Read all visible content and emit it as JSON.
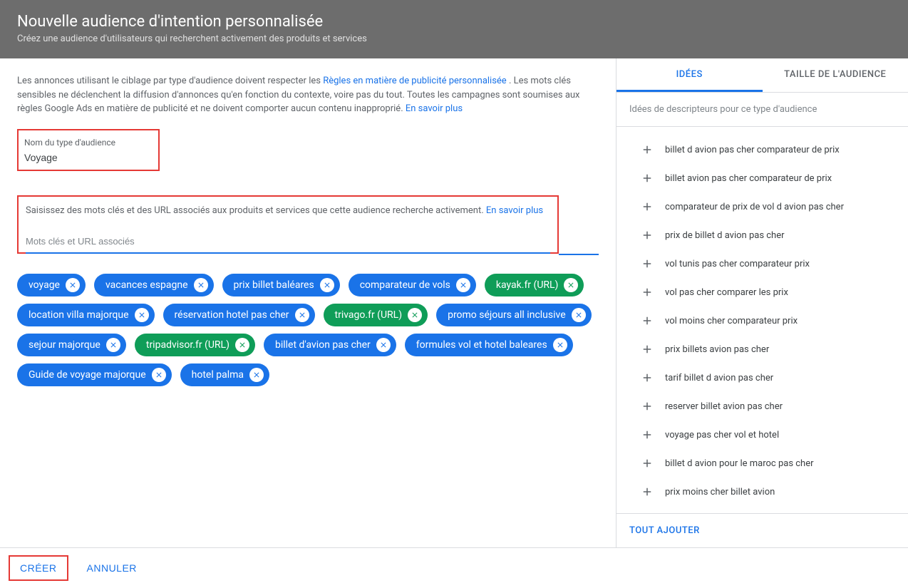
{
  "header": {
    "title": "Nouvelle audience d'intention personnalisée",
    "subtitle": "Créez une audience d'utilisateurs qui recherchent activement des produits et services"
  },
  "policy": {
    "text_before": "Les annonces utilisant le ciblage par type d'audience doivent respecter les ",
    "link1": "Règles en matière de publicité personnalisée",
    "text_mid": ". Les mots clés sensibles ne déclenchent la diffusion d'annonces qu'en fonction du contexte, voire pas du tout. Toutes les campagnes sont soumises aux règles Google Ads en matière de publicité et ne doivent comporter aucun contenu inapproprié. ",
    "link2": "En savoir plus"
  },
  "name_field": {
    "label": "Nom du type d'audience",
    "value": "Voyage"
  },
  "keywords_section": {
    "instruction": "Saisissez des mots clés et des URL associés aux produits et services que cette audience recherche activement. ",
    "learn_more": "En savoir plus",
    "placeholder": "Mots clés et URL associés"
  },
  "chips": [
    {
      "label": "voyage",
      "type": "kw"
    },
    {
      "label": "vacances espagne",
      "type": "kw"
    },
    {
      "label": "prix billet baléares",
      "type": "kw"
    },
    {
      "label": "comparateur de vols",
      "type": "kw"
    },
    {
      "label": "kayak.fr (URL)",
      "type": "url"
    },
    {
      "label": "location villa majorque",
      "type": "kw"
    },
    {
      "label": "réservation hotel pas cher",
      "type": "kw"
    },
    {
      "label": "trivago.fr (URL)",
      "type": "url"
    },
    {
      "label": "promo séjours all inclusive",
      "type": "kw"
    },
    {
      "label": "sejour majorque",
      "type": "kw"
    },
    {
      "label": "tripadvisor.fr (URL)",
      "type": "url"
    },
    {
      "label": "billet d'avion pas cher",
      "type": "kw"
    },
    {
      "label": "formules vol et hotel baleares",
      "type": "kw"
    },
    {
      "label": "Guide de voyage majorque",
      "type": "kw"
    },
    {
      "label": "hotel palma",
      "type": "kw"
    }
  ],
  "tabs": {
    "ideas": "IDÉES",
    "size": "TAILLE DE L'AUDIENCE"
  },
  "ideas_hint": "Idées de descripteurs pour ce type d'audience",
  "ideas": [
    "billet d avion pas cher comparateur de prix",
    "billet avion pas cher comparateur de prix",
    "comparateur de prix de vol d avion pas cher",
    "prix de billet d avion pas cher",
    "vol tunis pas cher comparateur prix",
    "vol pas cher comparer les prix",
    "vol moins cher comparateur prix",
    "prix billets avion pas cher",
    "tarif billet d avion pas cher",
    "reserver billet avion pas cher",
    "voyage pas cher vol et hotel",
    "billet d avion pour le maroc pas cher",
    "prix moins cher billet avion"
  ],
  "add_all": "TOUT AJOUTER",
  "footer": {
    "create": "CRÉER",
    "cancel": "ANNULER"
  }
}
